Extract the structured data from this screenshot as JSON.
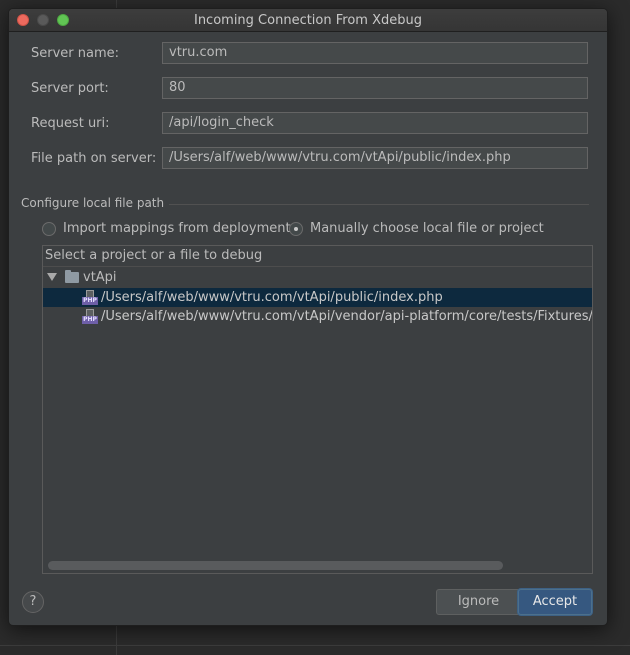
{
  "window": {
    "title": "Incoming Connection From Xdebug"
  },
  "fields": [
    {
      "label": "Server name:",
      "value": "vtru.com"
    },
    {
      "label": "Server port:",
      "value": "80"
    },
    {
      "label": "Request uri:",
      "value": "/api/login_check"
    },
    {
      "label": "File path on server:",
      "value": "/Users/alf/web/www/vtru.com/vtApi/public/index.php"
    }
  ],
  "section": {
    "title": "Configure local file path"
  },
  "radios": [
    {
      "label": "Import mappings from deployment",
      "checked": false
    },
    {
      "label": "Manually choose local file or project",
      "checked": true
    }
  ],
  "tree": {
    "header": "Select a project or a file to debug",
    "root": {
      "label": "vtApi",
      "icon": "folder-icon"
    },
    "items": [
      {
        "label": "/Users/alf/web/www/vtru.com/vtApi/public/index.php",
        "icon": "php-file-icon",
        "icon_text": "PHP",
        "selected": true
      },
      {
        "label": "/Users/alf/web/www/vtru.com/vtApi/vendor/api-platform/core/tests/Fixtures/app/web/index.php",
        "icon": "php-file-icon",
        "icon_text": "PHP",
        "selected": false
      }
    ]
  },
  "buttons": {
    "help": "?",
    "ignore": "Ignore",
    "accept": "Accept"
  },
  "colors": {
    "selection": "#0d293e",
    "accent": "#365880"
  }
}
